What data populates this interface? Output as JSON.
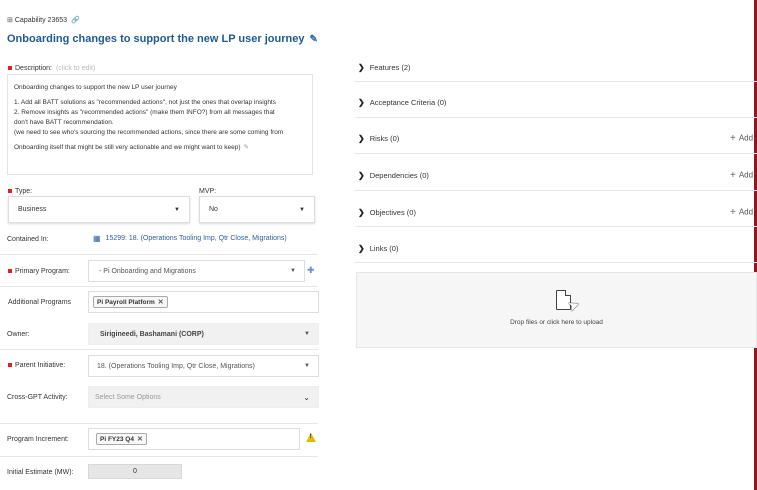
{
  "header": {
    "capability_id": "Capability 23653",
    "title": "Onboarding changes to support the new LP user journey"
  },
  "description": {
    "label": "Description:",
    "hint": "(click to edit)",
    "lines": [
      "Onboarding changes to support the new LP user journey",
      "1. Add all BATT solutions as \"recommended actions\", not just the ones that overlap insights",
      "2. Remove insights as \"recommended actions\" (make them INFO?) from all messages that",
      "don't have BATT recommendation.",
      "(we need to see who's sourcing the recommended actions, since there are some coming from",
      "Onboarding itself that might be still very actionable and we might want to keep)"
    ]
  },
  "type": {
    "label": "Type:",
    "value": "Business"
  },
  "mvp": {
    "label": "MVP:",
    "value": "No"
  },
  "contained_in": {
    "label": "Contained In:",
    "value": "15299: 18. (Operations Tooling Imp, Qtr Close, Migrations)"
  },
  "primary_program": {
    "label": "Primary Program:",
    "value": "- Pi Onboarding and Migrations"
  },
  "additional_programs": {
    "label": "Additional Programs",
    "tags": [
      "Pi Payroll Platform"
    ]
  },
  "owner": {
    "label": "Owner:",
    "value": "Sirigineedi, Bashamani (CORP)"
  },
  "parent_initiative": {
    "label": "Parent Initiative:",
    "value": "18. (Operations Tooling Imp, Qtr Close, Migrations)"
  },
  "cross_gpt": {
    "label": "Cross-GPT Activity:",
    "placeholder": "Select Some Options"
  },
  "program_increment": {
    "label": "Program Increment:",
    "tags": [
      "Pi FY23 Q4"
    ]
  },
  "initial_estimate": {
    "label": "Initial Estimate (MW):",
    "value": "0"
  },
  "sections": [
    {
      "label": "Features (2)",
      "add": ""
    },
    {
      "label": "Acceptance Criteria (0)",
      "add": ""
    },
    {
      "label": "Risks (0)",
      "add": "Add"
    },
    {
      "label": "Dependencies (0)",
      "add": "Add"
    },
    {
      "label": "Objectives (0)",
      "add": "Add"
    },
    {
      "label": "Links (0)",
      "add": ""
    }
  ],
  "upload": {
    "text": "Drop files or click here to upload"
  },
  "colors": {
    "title": "#1f5a96",
    "link": "#2c5f9e",
    "required": "#dd2222",
    "warning": "#e6b800",
    "right_rule": "#8b1b1b"
  }
}
